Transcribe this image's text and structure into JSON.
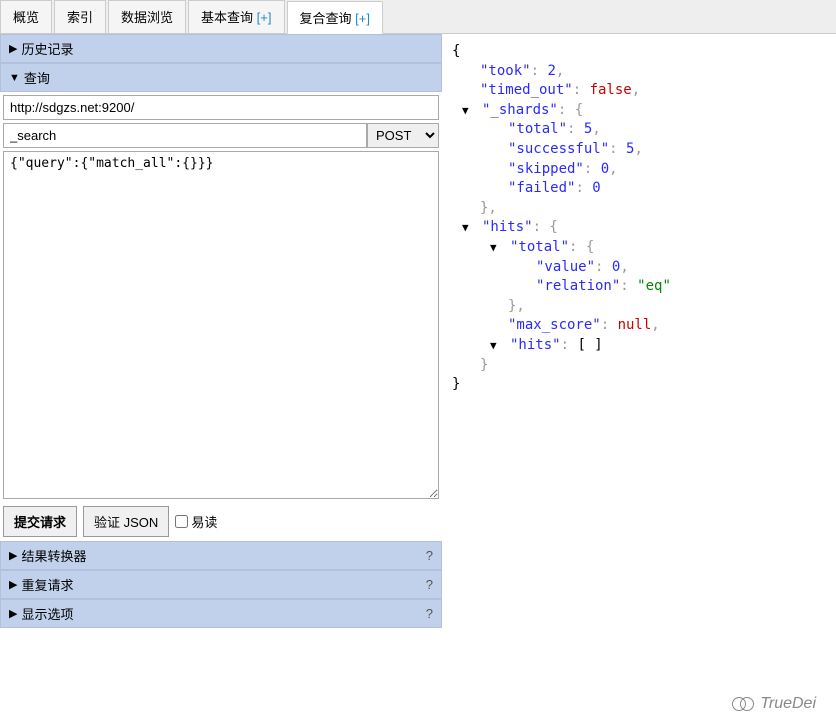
{
  "tabs": [
    {
      "label": "概览",
      "plus": ""
    },
    {
      "label": "索引",
      "plus": ""
    },
    {
      "label": "数据浏览",
      "plus": ""
    },
    {
      "label": "基本查询",
      "plus": " [+]"
    },
    {
      "label": "复合查询",
      "plus": " [+]"
    }
  ],
  "active_tab": 4,
  "sections": {
    "history": "历史记录",
    "query": "查询",
    "result_transformer": "结果转换器",
    "repeat_request": "重复请求",
    "display_options": "显示选项"
  },
  "form": {
    "url": "http://sdgzs.net:9200/",
    "path": "_search",
    "method": "POST",
    "body": "{\"query\":{\"match_all\":{}}}"
  },
  "buttons": {
    "submit": "提交请求",
    "validate": "验证 JSON",
    "pretty": "易读"
  },
  "response": {
    "took": 2,
    "timed_out": false,
    "_shards": {
      "total": 5,
      "successful": 5,
      "skipped": 0,
      "failed": 0
    },
    "hits": {
      "total": {
        "value": 0,
        "relation": "eq"
      },
      "max_score": null,
      "hits_empty": "[ ]"
    }
  },
  "watermark": "TrueDei"
}
